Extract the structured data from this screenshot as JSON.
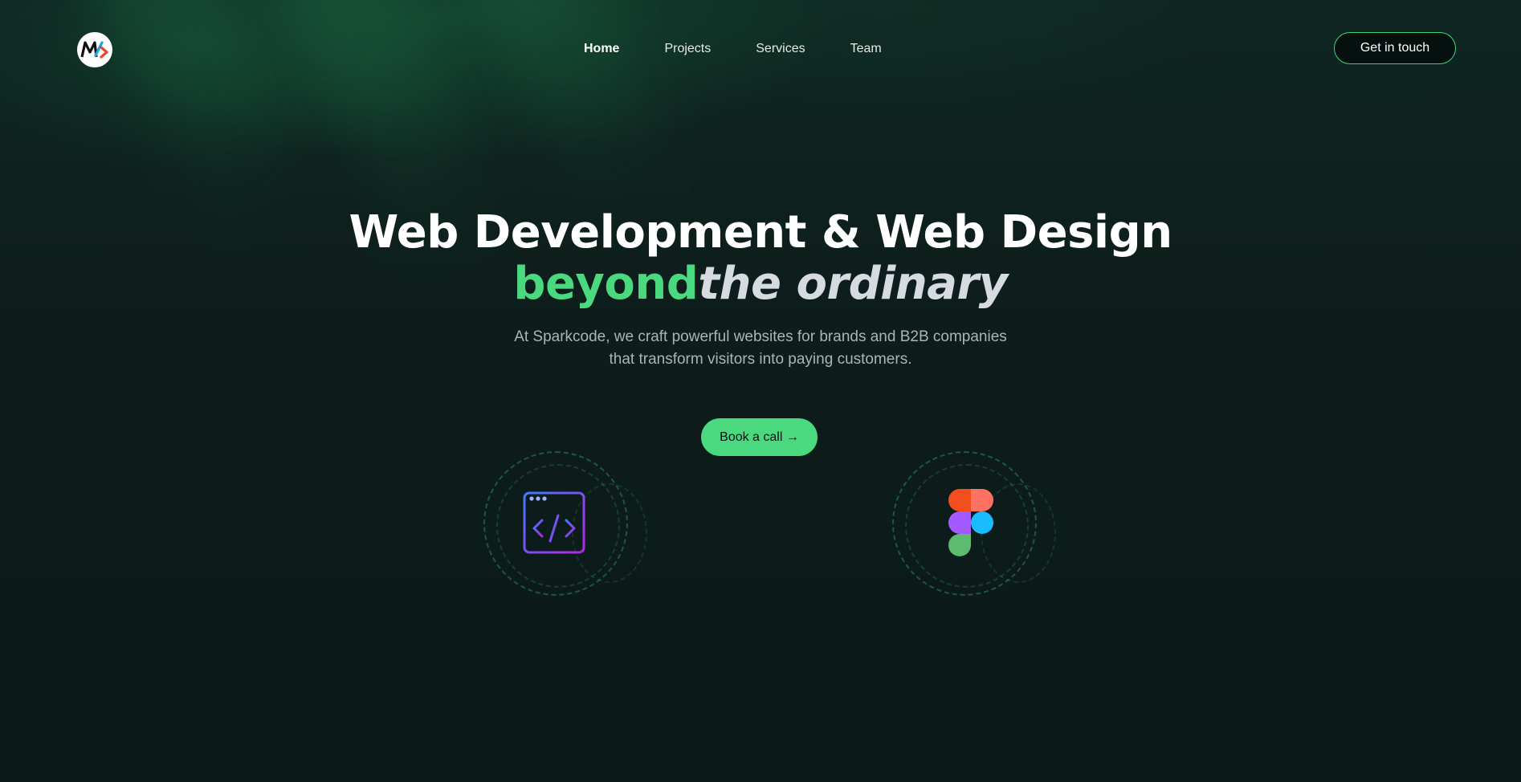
{
  "brand": {
    "logo_icon": "sparkcode-logo-icon"
  },
  "nav": {
    "items": [
      {
        "label": "Home",
        "active": true
      },
      {
        "label": "Projects",
        "active": false
      },
      {
        "label": "Services",
        "active": false
      },
      {
        "label": "Team",
        "active": false
      }
    ]
  },
  "header": {
    "cta_label": "Get in touch"
  },
  "hero": {
    "title_line1": "Web Development & Web Design",
    "title_green": "beyond",
    "title_italic": "the ordinary",
    "subtitle_line1": "At Sparkcode, we craft powerful websites for brands and B2B companies",
    "subtitle_line2": "that transform visitors into paying customers.",
    "cta_label": "Book a call →"
  },
  "feature_icons": [
    {
      "name": "code-window-icon"
    },
    {
      "name": "figma-icon"
    }
  ],
  "colors": {
    "accent": "#4ad97e",
    "background": "#0d1c1a",
    "text": "#ffffff",
    "muted": "#a9b7b4"
  }
}
